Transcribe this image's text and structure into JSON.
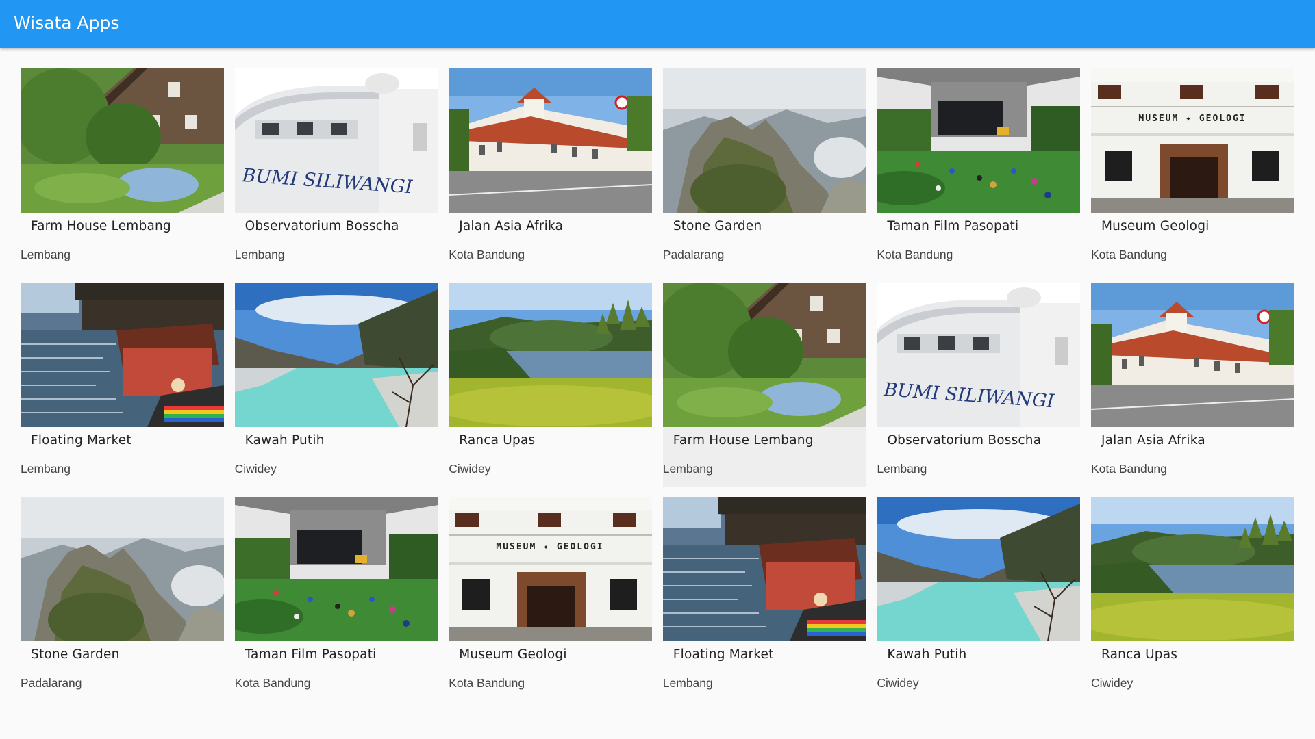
{
  "app": {
    "title": "Wisata Apps"
  },
  "cards": [
    {
      "title": "Farm House Lembang",
      "location": "Lembang",
      "scene": "farm"
    },
    {
      "title": "Observatorium Bosscha",
      "location": "Lembang",
      "scene": "bosscha",
      "sign": "BUMI SILIWANGI"
    },
    {
      "title": "Jalan Asia Afrika",
      "location": "Kota Bandung",
      "scene": "asia"
    },
    {
      "title": "Stone Garden",
      "location": "Padalarang",
      "scene": "stone"
    },
    {
      "title": "Taman Film Pasopati",
      "location": "Kota Bandung",
      "scene": "film"
    },
    {
      "title": "Museum Geologi",
      "location": "Kota Bandung",
      "scene": "museum",
      "sign": "MUSEUM ✦ GEOLOGI"
    },
    {
      "title": "Floating Market",
      "location": "Lembang",
      "scene": "floating"
    },
    {
      "title": "Kawah Putih",
      "location": "Ciwidey",
      "scene": "kawah"
    },
    {
      "title": "Ranca Upas",
      "location": "Ciwidey",
      "scene": "ranca"
    },
    {
      "title": "Farm House Lembang",
      "location": "Lembang",
      "scene": "farm",
      "hover": true
    },
    {
      "title": "Observatorium Bosscha",
      "location": "Lembang",
      "scene": "bosscha",
      "sign": "BUMI SILIWANGI"
    },
    {
      "title": "Jalan Asia Afrika",
      "location": "Kota Bandung",
      "scene": "asia"
    },
    {
      "title": "Stone Garden",
      "location": "Padalarang",
      "scene": "stone"
    },
    {
      "title": "Taman Film Pasopati",
      "location": "Kota Bandung",
      "scene": "film"
    },
    {
      "title": "Museum Geologi",
      "location": "Kota Bandung",
      "scene": "museum",
      "sign": "MUSEUM ✦ GEOLOGI"
    },
    {
      "title": "Floating Market",
      "location": "Lembang",
      "scene": "floating"
    },
    {
      "title": "Kawah Putih",
      "location": "Ciwidey",
      "scene": "kawah"
    },
    {
      "title": "Ranca Upas",
      "location": "Ciwidey",
      "scene": "ranca"
    }
  ],
  "colors": {
    "appbar": "#2196f3",
    "background": "#fafafa",
    "hover": "#eeeeee"
  }
}
